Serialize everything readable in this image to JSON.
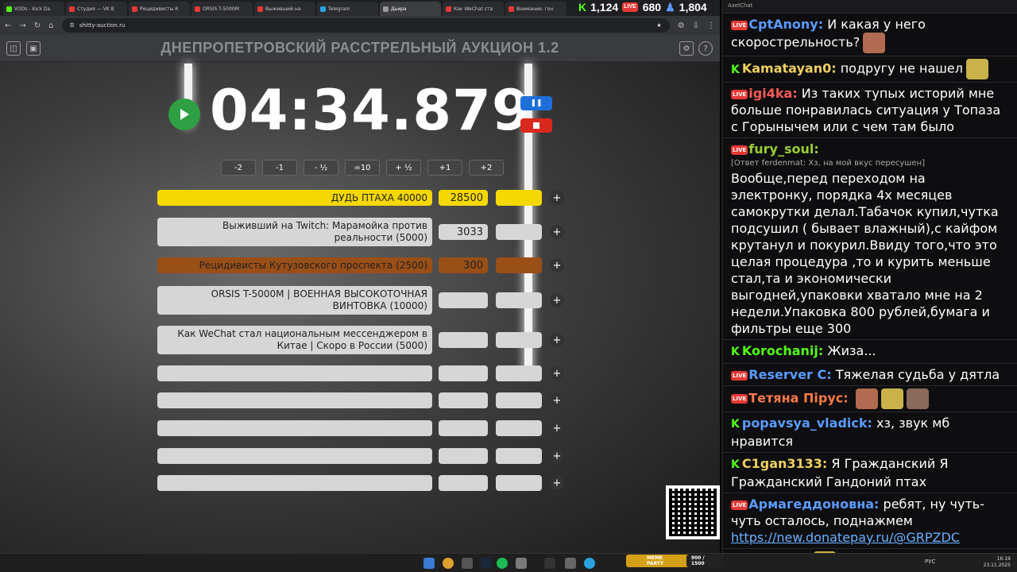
{
  "browser": {
    "tabs": [
      {
        "label": "VODs - Kick Da",
        "color": "#53fc18"
      },
      {
        "label": "Студия — VK В",
        "color": "#e53935"
      },
      {
        "label": "Рецидивисты К",
        "color": "#e53935"
      },
      {
        "label": "ORSIS T-5000M",
        "color": "#e53935"
      },
      {
        "label": "Выживший на",
        "color": "#e53935"
      },
      {
        "label": "Telegram",
        "color": "#2aa3e0"
      },
      {
        "label": "Дьира",
        "color": "#999999"
      },
      {
        "label": "Как WeChat ста",
        "color": "#e53935"
      },
      {
        "label": "Внимание: гон",
        "color": "#e53935"
      }
    ],
    "url": "shitty-auction.ru"
  },
  "stream_stats": {
    "kick": "1,124",
    "live": "680",
    "viewers": "1,804"
  },
  "auction": {
    "title": "ДНЕПРОПЕТРОВСКИЙ РАССТРЕЛЬНЫЙ АУКЦИОН 1.2",
    "timer": "04:34.879",
    "adjust_buttons": [
      "-2",
      "-1",
      "- ½",
      "=10",
      "+ ½",
      "+1",
      "+2"
    ],
    "lots": [
      {
        "name": "ДУДЬ ПТАХА 40000",
        "amount": "28500",
        "color": "#f5d800"
      },
      {
        "name": "Выживший на Twitch: Марамойка против реальности (5000)",
        "amount": "3033",
        "color": "#d6d6d6"
      },
      {
        "name": "Рецидивисты Кутузовского проспекта (2500)",
        "amount": "300",
        "color": "#9a4f17"
      },
      {
        "name": "ORSIS T-5000M | ВОЕННАЯ ВЫСОКОТОЧНАЯ ВИНТОВКА (10000)",
        "amount": "",
        "color": "#d6d6d6"
      },
      {
        "name": "Как WeChat стал национальным мессенджером в Китае | Скоро в России (5000)",
        "amount": "",
        "color": "#d6d6d6"
      },
      {
        "name": "",
        "amount": "",
        "color": "#d6d6d6"
      },
      {
        "name": "",
        "amount": "",
        "color": "#d6d6d6"
      },
      {
        "name": "",
        "amount": "",
        "color": "#d6d6d6"
      },
      {
        "name": "",
        "amount": "",
        "color": "#d6d6d6"
      },
      {
        "name": "",
        "amount": "",
        "color": "#d6d6d6"
      }
    ]
  },
  "meme_party": {
    "label": "MEME PARTY",
    "progress": "900 / 1500"
  },
  "system": {
    "lang": "РУС",
    "time": "16:19",
    "date": "23.11.2025"
  },
  "chat": {
    "window_title": "AxelChat",
    "messages": [
      {
        "platform": "live",
        "user": "CptAnony:",
        "user_color": "#5b9bff",
        "text": "И какая у него скорострельность?",
        "reply": "",
        "emotes": 1
      },
      {
        "platform": "kick",
        "user": "Kamatayan0:",
        "user_color": "#f0d060",
        "text": "подругу не нашел",
        "reply": "",
        "emotes": 1
      },
      {
        "platform": "live",
        "user": "igi4ka:",
        "user_color": "#ff5a5a",
        "text": "Из таких тупых историй мне больше понравилась ситуация у Топаза с Горынычем или с чем там было",
        "reply": "",
        "emotes": 0
      },
      {
        "platform": "live",
        "user": "fury_soul:",
        "user_color": "#9acd32",
        "text": "Вообще,перед переходом на электронку, порядка 4х месяцев самокрутки делал.Табачок купил,чутка подсушил ( бывает влажный),с кайфом крутанул и покурил.Ввиду того,что это целая процедура ,то и курить меньше стал,та и экономически выгодней,упаковки хватало мне на 2 недели.Упаковка 800 рублей,бумага и фильтры еще 300",
        "reply": "[Ответ ferdenmat: Хз, на мой вкус пересушен]",
        "emotes": 0
      },
      {
        "platform": "kick",
        "user": "Korochanij:",
        "user_color": "#53fc18",
        "text": "Жиза...",
        "reply": "",
        "emotes": 0
      },
      {
        "platform": "live",
        "user": "Reserver C:",
        "user_color": "#5b9bff",
        "text": "Тяжелая судьба у дятла",
        "reply": "",
        "emotes": 0
      },
      {
        "platform": "live",
        "user": "Тетяна Пірус:",
        "user_color": "#ff7a4a",
        "text": "",
        "reply": "",
        "emotes": 3
      },
      {
        "platform": "kick",
        "user": "popavsya_vladick:",
        "user_color": "#5b9bff",
        "text": "хз, звук мб нравится",
        "reply": "",
        "emotes": 0
      },
      {
        "platform": "kick",
        "user": "C1gan3133:",
        "user_color": "#f0d060",
        "text": "Я Гражданский Я Гражданский Гандоний птах",
        "reply": "",
        "emotes": 0
      },
      {
        "platform": "live",
        "user": "Армагеддоновна:",
        "user_color": "#5b9bff",
        "text": "ребят, ну чуть-чуть осталось, поднажмем",
        "link": "https://new.donatepay.ru/@GRPZDC",
        "reply": "",
        "emotes": 0
      },
      {
        "platform": "kick",
        "user": "arcolord:",
        "user_color": "#5b9bff",
        "text": "",
        "reply": "",
        "emotes": 1
      }
    ]
  }
}
